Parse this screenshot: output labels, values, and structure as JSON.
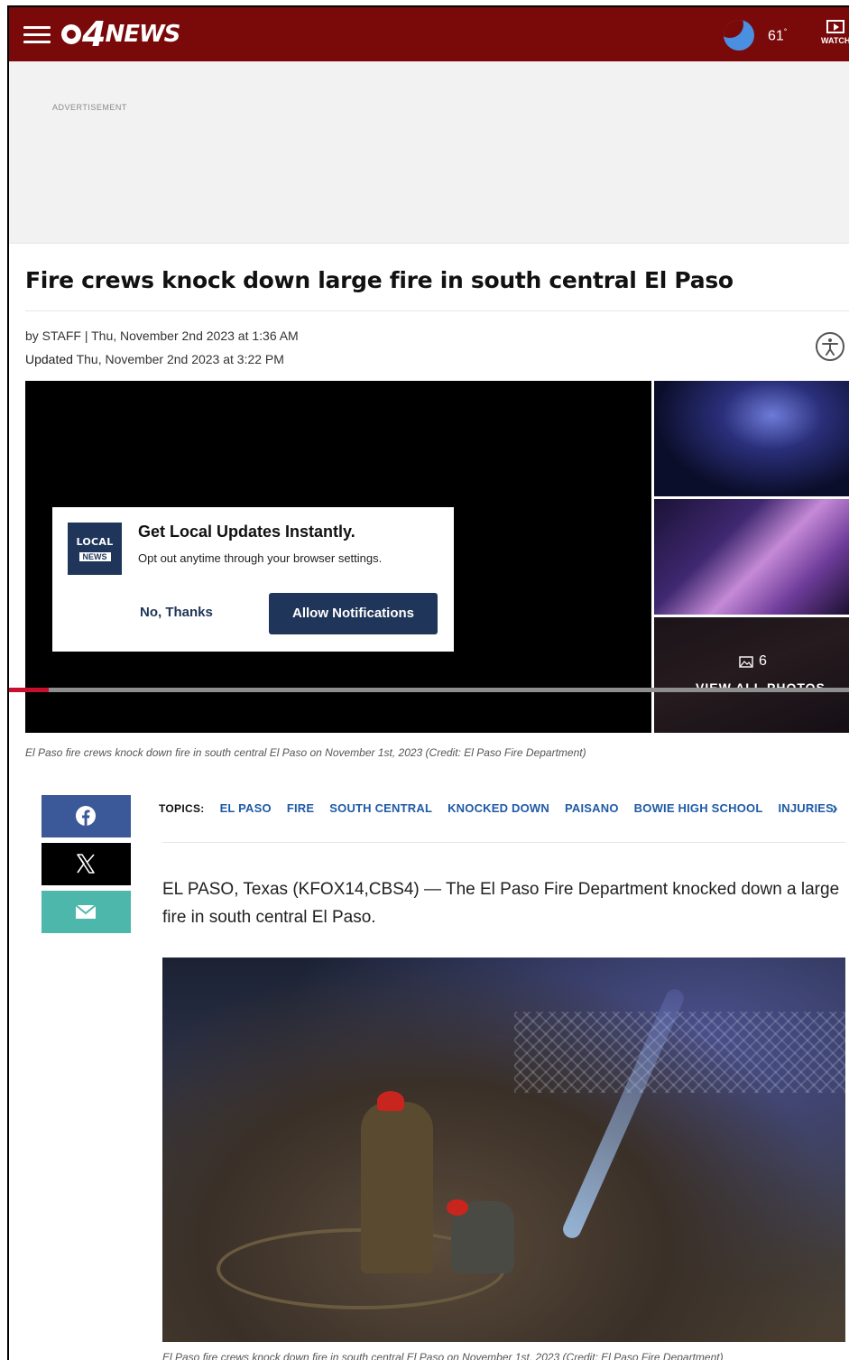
{
  "header": {
    "logo_number": "4",
    "logo_word": "NEWS",
    "temperature": "61",
    "degree": "°",
    "watch_label": "WATCH",
    "brand_color": "#7a0a0a"
  },
  "ad": {
    "label": "ADVERTISEMENT"
  },
  "article": {
    "headline": "Fire crews knock down large fire in south central El Paso",
    "byline": "by STAFF  |  Thu, November 2nd 2023 at 1:36 AM",
    "updated_label": "Updated",
    "updated_time": " Thu, November 2nd 2023 at 3:22 PM",
    "media_caption": "El Paso fire crews knock down fire in south central El Paso on November 1st, 2023 (Credit: El Paso Fire Department)",
    "photo_count": "6",
    "view_all_label": "VIEW ALL PHOTOS",
    "video_progress": 0.047,
    "body": "EL PASO, Texas (KFOX14,CBS4) — The El Paso Fire Department knocked down a large fire in south central El Paso.",
    "photo_caption": "El Paso fire crews knock down fire in south central El Paso on November 1st, 2023 (Credit: El Paso Fire Department)"
  },
  "notification": {
    "logo_line1": "LOCAL",
    "logo_line2": "NEWS",
    "title": "Get Local Updates Instantly.",
    "subtitle": "Opt out anytime through your browser settings.",
    "decline_label": "No, Thanks",
    "allow_label": "Allow Notifications"
  },
  "share": {
    "icons": [
      "facebook-icon",
      "x-icon",
      "mail-icon"
    ],
    "colors": {
      "facebook": "#3b5998",
      "x": "#000000",
      "mail": "#4cb7aa"
    }
  },
  "topics": {
    "label": "TOPICS:",
    "items": [
      "EL PASO",
      "FIRE",
      "SOUTH CENTRAL",
      "KNOCKED DOWN",
      "PAISANO",
      "BOWIE HIGH SCHOOL",
      "INJURIES"
    ],
    "next_icon": "›",
    "link_color": "#1f5aa6"
  }
}
